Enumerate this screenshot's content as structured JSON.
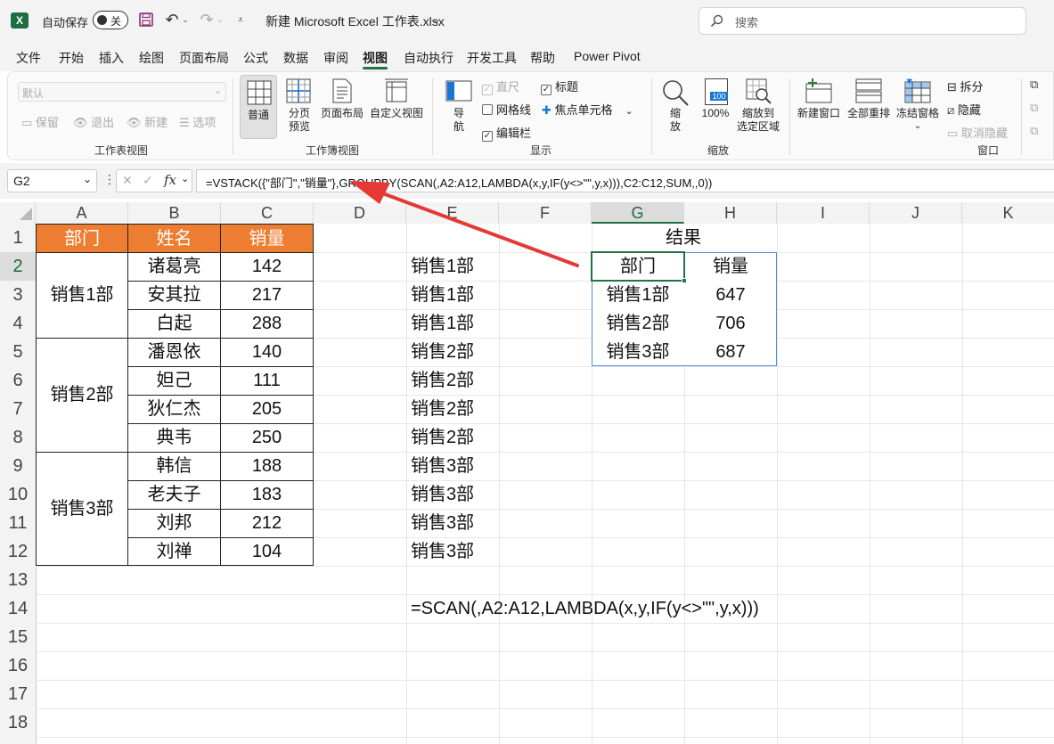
{
  "titlebar": {
    "autosave_label": "自动保存",
    "toggle_state": "关",
    "file_title": "新建 Microsoft Excel 工作表.xlsx",
    "search_placeholder": "搜索"
  },
  "menu_tabs": [
    "文件",
    "开始",
    "插入",
    "绘图",
    "页面布局",
    "公式",
    "数据",
    "审阅",
    "视图",
    "自动执行",
    "开发工具",
    "帮助",
    "Power Pivot"
  ],
  "active_tab": "视图",
  "ribbon": {
    "sheet_view": {
      "dropdown_value": "默认",
      "keep": "保留",
      "exit": "退出",
      "new": "新建",
      "options": "选项",
      "group_label": "工作表视图"
    },
    "workbook_view": {
      "normal": "普通",
      "page_break_1": "分页",
      "page_break_2": "预览",
      "page_layout": "页面布局",
      "custom_view": "自定义视图",
      "group_label": "工作簿视图"
    },
    "show": {
      "nav_1": "导",
      "nav_2": "航",
      "ruler": "直尺",
      "gridlines": "网格线",
      "formula_bar": "编辑栏",
      "headings": "标题",
      "focus_cell": "焦点单元格",
      "group_label": "显示"
    },
    "zoom": {
      "zoom_1": "缩",
      "zoom_2": "放",
      "hundred": "100%",
      "hundred_icon": "100",
      "zoom_sel_1": "缩放到",
      "zoom_sel_2": "选定区域",
      "group_label": "缩放"
    },
    "window": {
      "new_window": "新建窗口",
      "arrange_all": "全部重排",
      "freeze": "冻结窗格",
      "split": "拆分",
      "hide": "隐藏",
      "unhide": "取消隐藏",
      "group_label": "窗口"
    }
  },
  "formula_bar": {
    "name_box": "G2",
    "formula": "=VSTACK({\"部门\",\"销量\"},GROUPBY(SCAN(,A2:A12,LAMBDA(x,y,IF(y<>\"\",y,x))),C2:C12,SUM,,0))"
  },
  "columns": [
    "A",
    "B",
    "C",
    "D",
    "E",
    "F",
    "G",
    "H",
    "I",
    "J",
    "K"
  ],
  "rows": [
    "1",
    "2",
    "3",
    "4",
    "5",
    "6",
    "7",
    "8",
    "9",
    "10",
    "11",
    "12",
    "13",
    "14",
    "15",
    "16",
    "17",
    "18"
  ],
  "table": {
    "headers": [
      "部门",
      "姓名",
      "销量"
    ],
    "depts": [
      "销售1部",
      "销售2部",
      "销售3部"
    ],
    "names": [
      "诸葛亮",
      "安其拉",
      "白起",
      "潘恩依",
      "妲己",
      "狄仁杰",
      "典韦",
      "韩信",
      "老夫子",
      "刘邦",
      "刘禅"
    ],
    "sales": [
      "142",
      "217",
      "288",
      "140",
      "111",
      "205",
      "250",
      "188",
      "183",
      "212",
      "104"
    ]
  },
  "scan_results": [
    "销售1部",
    "销售1部",
    "销售1部",
    "销售2部",
    "销售2部",
    "销售2部",
    "销售2部",
    "销售3部",
    "销售3部",
    "销售3部",
    "销售3部"
  ],
  "scan_formula": "=SCAN(,A2:A12,LAMBDA(x,y,IF(y<>\"\",y,x)))",
  "result": {
    "title": "结果",
    "headers": [
      "部门",
      "销量"
    ],
    "rows": [
      [
        "销售1部",
        "647"
      ],
      [
        "销售2部",
        "706"
      ],
      [
        "销售3部",
        "687"
      ]
    ]
  },
  "colors": {
    "header_orange": "#ed7d31",
    "excel_green": "#217346",
    "arrow_red": "#e53935",
    "result_border": "#4a90d9"
  }
}
